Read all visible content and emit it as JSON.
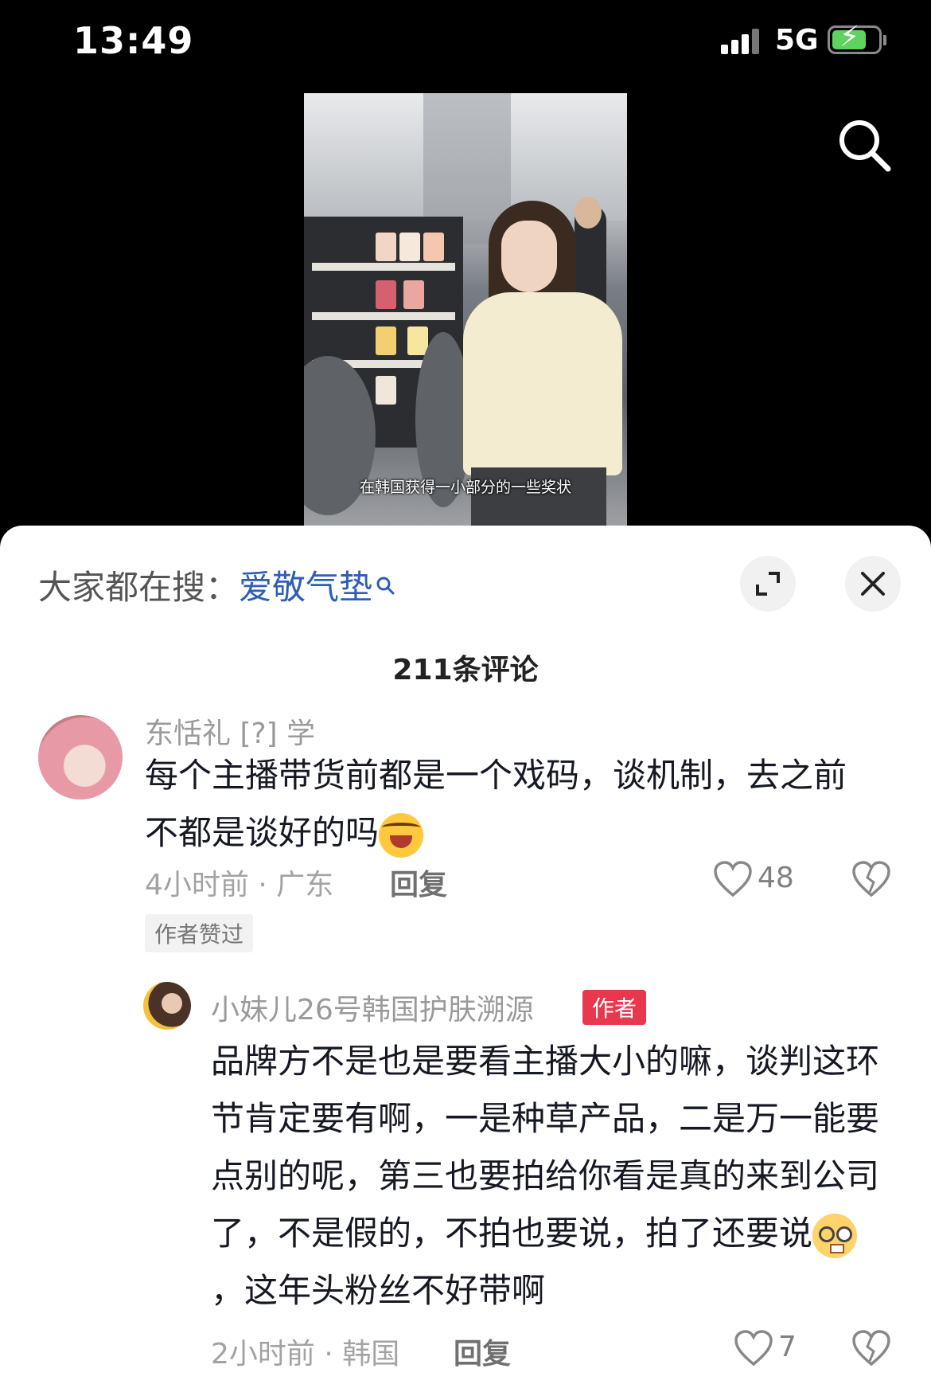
{
  "status_bar": {
    "time": "13:49",
    "network": "5G",
    "battery_color": "#5fd35f"
  },
  "video": {
    "subtitle": "在韩国获得一小部分的一些奖状"
  },
  "comments_sheet": {
    "search_hint": {
      "prefix": "大家都在搜：",
      "keyword": "爱敬气垫"
    },
    "title": "211条评论",
    "comments": [
      {
        "username": "东恬礼 [?] 学",
        "text": "每个主播带货前都是一个戏码，谈机制，去之前不都是谈好的吗",
        "emoji": "laughing-tears-icon",
        "time_location": "4小时前 · 广东",
        "reply_label": "回复",
        "likes": "48",
        "author_liked_label": "作者赞过"
      },
      {
        "username": "小妹儿26号韩国护肤溯源",
        "author_badge": "作者",
        "text_part1": "品牌方不是也是要看主播大小的嘛，谈判这环节肯定要有啊，一是种草产品，二是万一能要点别的呢，第三也要拍给你看是真的来到公司了，不是假的，不拍也要说，拍了还要说",
        "emoji": "nerd-face-icon",
        "text_part2": "，这年头粉丝不好带啊",
        "time_location": "2小时前 · 韩国",
        "reply_label": "回复",
        "likes": "7"
      }
    ]
  }
}
